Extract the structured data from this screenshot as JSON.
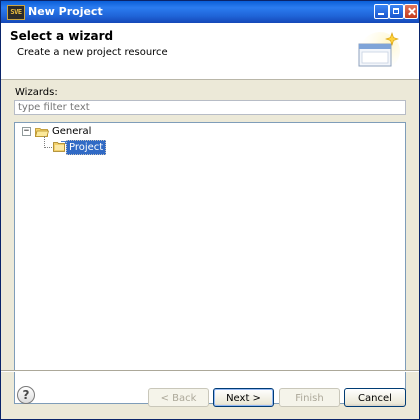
{
  "window": {
    "app_badge": "SVE",
    "title": "New Project"
  },
  "header": {
    "title": "Select a wizard",
    "description": "Create a new project resource"
  },
  "wizards": {
    "label": "Wizards:",
    "filter_placeholder": "type filter text",
    "filter_value": "",
    "tree": [
      {
        "label": "General",
        "expanded": true,
        "toggle_symbol": "−",
        "children": [
          {
            "label": "Project",
            "selected": true
          }
        ]
      }
    ]
  },
  "footer": {
    "help_symbol": "?",
    "back_label": "< Back",
    "next_label": "Next >",
    "finish_label": "Finish",
    "cancel_label": "Cancel"
  },
  "colors": {
    "title_bar": "#1f63d6",
    "selection": "#316ac5",
    "dialog_bg": "#ece9d8"
  }
}
